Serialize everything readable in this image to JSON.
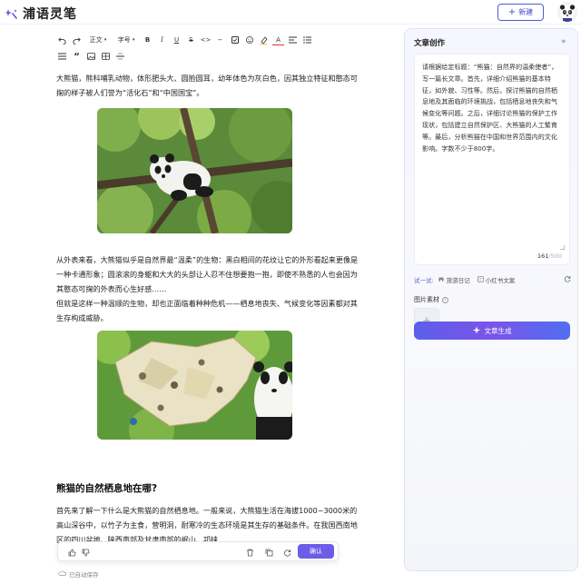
{
  "app": {
    "title": "浦语灵笔"
  },
  "header": {
    "new_label": "新建",
    "new_icon": "plus-icon"
  },
  "toolbar": {
    "row1": [
      {
        "name": "undo-icon",
        "label": ""
      },
      {
        "name": "redo-icon",
        "label": ""
      },
      {
        "name": "paragraph-style-select",
        "label": "正文"
      },
      {
        "name": "font-size-select",
        "label": "字号"
      },
      {
        "name": "bold-icon",
        "label": "B"
      },
      {
        "name": "italic-icon",
        "label": "I"
      },
      {
        "name": "underline-icon",
        "label": "U"
      },
      {
        "name": "strikethrough-icon",
        "label": "S"
      },
      {
        "name": "code-icon",
        "label": "<>"
      },
      {
        "name": "minus-icon",
        "label": "−"
      },
      {
        "name": "checkbox-icon",
        "label": ""
      },
      {
        "name": "emoji-icon",
        "label": ""
      },
      {
        "name": "highlight-icon",
        "label": ""
      },
      {
        "name": "font-color-icon",
        "label": "A"
      },
      {
        "name": "align-icon",
        "label": ""
      },
      {
        "name": "list-icon",
        "label": ""
      }
    ],
    "row2": [
      {
        "name": "ordered-list-icon",
        "label": ""
      },
      {
        "name": "quote-icon",
        "label": "“"
      },
      {
        "name": "image-icon",
        "label": ""
      },
      {
        "name": "table-icon",
        "label": ""
      },
      {
        "name": "divider-icon",
        "label": ""
      }
    ]
  },
  "article": {
    "p1": "大熊猫，熊科哺乳动物，体形肥头大、圆脸圆耳，幼年体色为灰白色，因其独立特征和憨态可掬的样子被人们誉为“活化石”和“中国国宝”。",
    "p2": "从外表来看，大熊猫似乎是自然界最“温柔”的生物：黑白相间的花纹让它的外形看起来更像是一种卡通形象；圆滚滚的身躯和大大的头部让人忍不住想要抱一抱，即使不熟悉的人也会因为其憨态可掬的外表而心生好感……",
    "p3": "但就是这样一种温顺的生物，却也正面临着种种危机——栖息地丧失、气候变化等因素都对其生存构成威胁。",
    "heading": "熊猫的自然栖息地在哪?",
    "p4": "首先来了解一下什么是大熊猫的自然栖息地。一般来说，大熊猫生活在海拔1000~3000米的高山深谷中，以竹子为主食，营明洞，耐寒冷的生态环境是其生存的基础条件。在我国西南地区的四川盆地、陕西南部及甘肃南部的岷山、邛崃"
  },
  "actionbar": {
    "confirm_label": "确认"
  },
  "autosave": {
    "label": "已自动保存"
  },
  "panel": {
    "title": "文章创作",
    "prompt": "请根据给定标题：“熊猫：自然界的温柔使者”，写一篇长文章。首先，详细介绍熊猫的基本特征，如外貌、习性等。然后，探讨熊猫的自然栖息地及其面临的环境挑战，包括栖息地丧失和气候变化等问题。之后，详细讨论熊猫的保护工作现状，包括建立自然保护区、大熊猫的人工繁育等。最后，分析熊猫在中国和世界范围内的文化影响。字数不少于800字。",
    "char_count": "161",
    "char_max": "/500",
    "try_label": "试一试:",
    "try_options": [
      "旅游日记",
      "小红书文案"
    ],
    "image_label": "图片素材",
    "generate_label": "文章生成"
  },
  "colors": {
    "accent": "#6c5ce7",
    "brand": "#4f5bd5"
  }
}
